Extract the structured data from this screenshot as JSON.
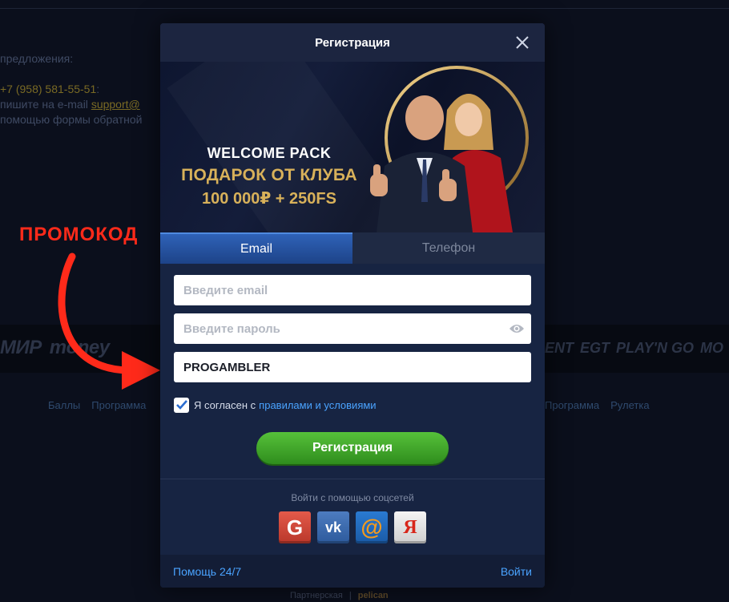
{
  "background": {
    "contact": {
      "offers_label": "предложения:",
      "phone": "+7 (958) 581-55-51",
      "email_prefix": "пишите на e-mail",
      "email": "support@",
      "form_text": "помощью формы обратной"
    },
    "payments_left": [
      "МИР",
      "money"
    ],
    "payments_right": [
      "ENT",
      "EGT",
      "PLAY'N GO",
      "MO"
    ],
    "footer_links_left": [
      "Баллы",
      "Программа"
    ],
    "footer_links_right": [
      "Программа",
      "Рулетка"
    ],
    "partner": {
      "label": "Партнерская",
      "separator": "|",
      "brand": "pelican"
    }
  },
  "annotation": {
    "label": "ПРОМОКОД"
  },
  "modal": {
    "title": "Регистрация",
    "close_icon": "close-icon",
    "banner": {
      "line1": "WELCOME PACK",
      "line2": "ПОДАРОК ОТ КЛУБА",
      "line3": "100 000₽ + 250FS"
    },
    "tabs": [
      {
        "label": "Email",
        "active": true
      },
      {
        "label": "Телефон",
        "active": false
      }
    ],
    "form": {
      "email_placeholder": "Введите email",
      "email_value": "",
      "password_placeholder": "Введите пароль",
      "password_value": "",
      "promo_value": "PROGAMBLER",
      "agree_text": "Я согласен с",
      "agree_link": "правилами и условиями",
      "agree_checked": true,
      "submit_label": "Регистрация"
    },
    "social": {
      "title": "Войти с помощью соцсетей",
      "buttons": [
        {
          "name": "google",
          "glyph": "G"
        },
        {
          "name": "vk",
          "glyph": "vk"
        },
        {
          "name": "mail",
          "glyph": "@"
        },
        {
          "name": "yandex",
          "glyph": "Я"
        }
      ]
    },
    "footer": {
      "help": "Помощь 24/7",
      "login": "Войти"
    }
  },
  "colors": {
    "accent_blue": "#4aa3ff",
    "submit_green": "#3fa62a",
    "promo_red": "#ff2a1a",
    "banner_gold": "#d8b15a"
  }
}
